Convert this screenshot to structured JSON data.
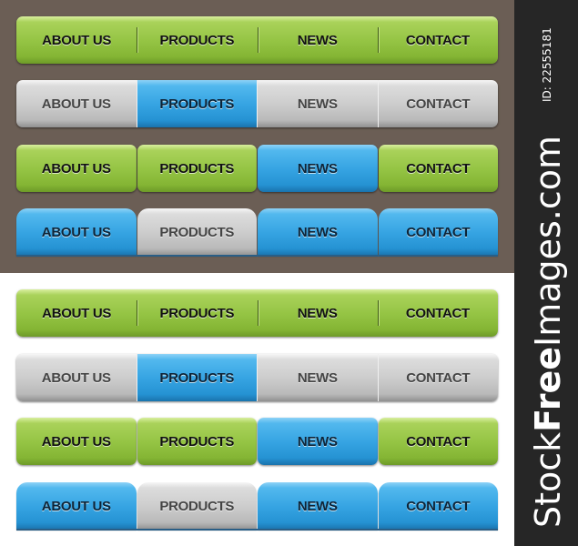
{
  "watermark": {
    "brand_prefix": "Stock",
    "brand_bold": "Free",
    "brand_suffix": "Images.com",
    "id_text": "ID: 22555181"
  },
  "colors": {
    "green": "#96c545",
    "blue": "#37a5e3",
    "gray": "#cdcdcd",
    "dark_background": "#6b5e55",
    "light_background": "#ffffff",
    "sidebar": "#262626"
  },
  "menu_labels": [
    "ABOUT US",
    "PRODUCTS",
    "NEWS",
    "CONTACT"
  ],
  "sections": [
    {
      "name": "dark",
      "bars": [
        {
          "style": "joined-divided",
          "colors": [
            "green",
            "green",
            "green",
            "green"
          ]
        },
        {
          "style": "joined",
          "colors": [
            "gray",
            "blue",
            "gray",
            "gray"
          ]
        },
        {
          "style": "split",
          "colors": [
            "green",
            "green",
            "blue",
            "green"
          ]
        },
        {
          "style": "top-tabs",
          "colors": [
            "blue",
            "gray",
            "blue",
            "blue"
          ]
        }
      ]
    },
    {
      "name": "light",
      "bars": [
        {
          "style": "joined-divided",
          "colors": [
            "green",
            "green",
            "green",
            "green"
          ]
        },
        {
          "style": "joined",
          "colors": [
            "gray",
            "blue",
            "gray",
            "gray"
          ]
        },
        {
          "style": "split",
          "colors": [
            "green",
            "green",
            "blue",
            "green"
          ]
        },
        {
          "style": "top-tabs",
          "colors": [
            "blue",
            "gray",
            "blue",
            "blue"
          ]
        }
      ]
    }
  ]
}
